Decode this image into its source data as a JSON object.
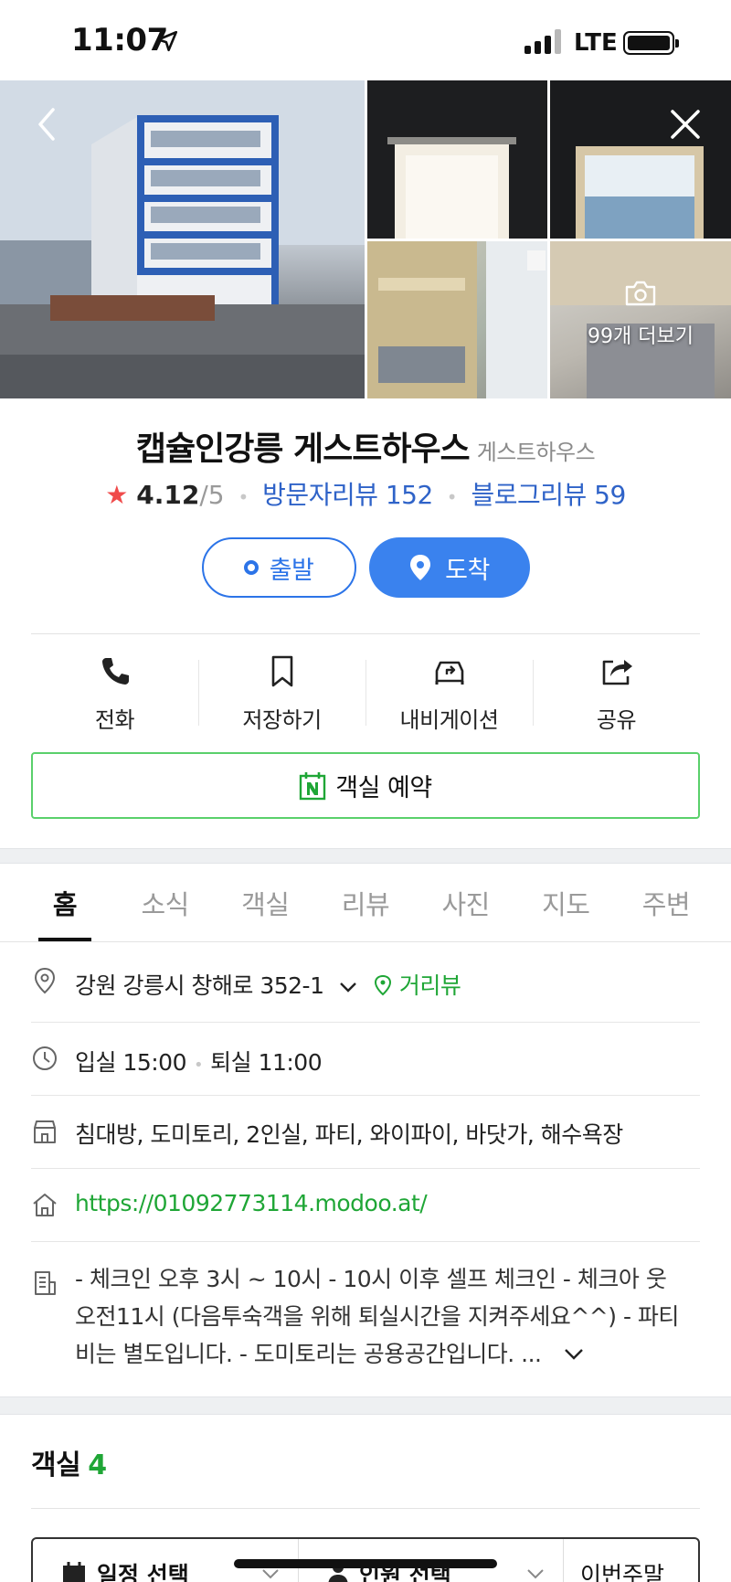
{
  "status_bar": {
    "time": "11:07",
    "network": "LTE"
  },
  "photos": {
    "more_label": "99개 더보기"
  },
  "place": {
    "name": "캡슐인강릉 게스트하우스",
    "category": "게스트하우스",
    "rating": "4.12",
    "rating_max": "/5",
    "visitor_reviews": "방문자리뷰 152",
    "blog_reviews": "블로그리뷰 59"
  },
  "route": {
    "start_label": "출발",
    "end_label": "도착"
  },
  "actions": [
    {
      "label": "전화",
      "icon": "phone-icon"
    },
    {
      "label": "저장하기",
      "icon": "bookmark-icon"
    },
    {
      "label": "내비게이션",
      "icon": "car-navigation-icon"
    },
    {
      "label": "공유",
      "icon": "share-icon"
    }
  ],
  "booking": {
    "label": "객실 예약"
  },
  "tabs": [
    "홈",
    "소식",
    "객실",
    "리뷰",
    "사진",
    "지도",
    "주변"
  ],
  "info": {
    "address": "강원 강릉시 창해로 352-1",
    "street_view": "거리뷰",
    "checkin": "입실 15:00",
    "checkout": "퇴실 11:00",
    "facilities": "침대방, 도미토리, 2인실, 파티, 와이파이, 바닷가, 해수욕장",
    "url": "https://01092773114.modoo.at/",
    "description_lines": [
      "- 체크인 오후 3시 ~ 10시 - 10시 이후 셀프 체크인 - 체크아 웃",
      "오전11시 (다음투숙객을 위해 퇴실시간을 지켜주세요^^) - 파티",
      "비는 별도입니다. - 도미토리는 공용공간입니다. ..."
    ]
  },
  "rooms": {
    "title": "객실",
    "count": "4",
    "filter_date": "일정 선택",
    "filter_people": "인원 선택",
    "filter_weekend": "이번주말"
  },
  "colors": {
    "accent_blue": "#3a82ee",
    "naver_green": "#1fa636",
    "link_blue": "#2f63c8",
    "star_red": "#f04b4b"
  }
}
